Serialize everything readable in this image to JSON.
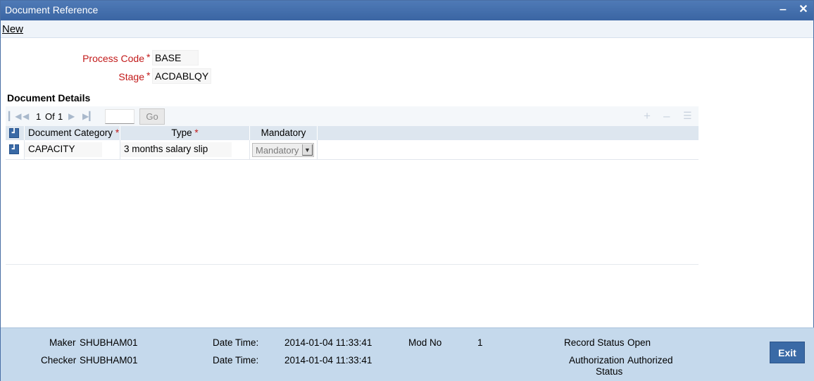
{
  "window": {
    "title": "Document Reference",
    "minimize_label": "‒",
    "close_label": "✕"
  },
  "menu": {
    "new_label": "New"
  },
  "form": {
    "process_code_label": "Process Code",
    "process_code_value": "BASE",
    "stage_label": "Stage",
    "stage_value": "ACDABLQY",
    "required_mark": "*"
  },
  "document_details": {
    "title": "Document Details",
    "pager": {
      "current": "1",
      "of_label": "Of",
      "total": "1",
      "go_label": "Go"
    },
    "columns": {
      "category": "Document Category",
      "type": "Type",
      "mandatory": "Mandatory"
    },
    "rows": [
      {
        "category": "CAPACITY",
        "type": "3 months salary slip",
        "mandatory": "Mandatory"
      }
    ]
  },
  "footer": {
    "maker_label": "Maker",
    "maker_value": "SHUBHAM01",
    "checker_label": "Checker",
    "checker_value": "SHUBHAM01",
    "date_time_label": "Date Time:",
    "maker_date_time": "2014-01-04 11:33:41",
    "checker_date_time": "2014-01-04 11:33:41",
    "mod_no_label": "Mod No",
    "mod_no_value": "1",
    "record_status_label": "Record Status",
    "record_status_value": "Open",
    "auth_status_label_line1": "Authorization",
    "auth_status_label_line2": "Status",
    "auth_status_value": "Authorized",
    "exit_label": "Exit"
  },
  "icons": {
    "first": "first-page-icon",
    "prev": "previous-page-icon",
    "next": "next-page-icon",
    "last": "last-page-icon",
    "add": "add-row-icon",
    "delete": "delete-row-icon",
    "view": "single-view-icon"
  }
}
